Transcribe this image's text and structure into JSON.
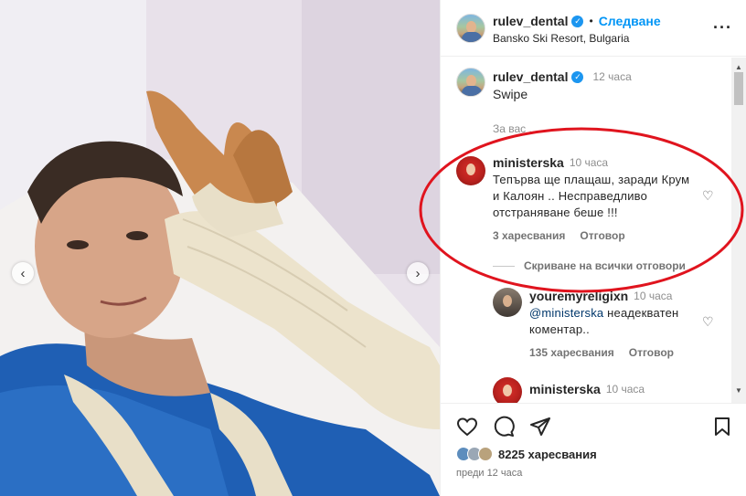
{
  "post": {
    "author": "rulev_dental",
    "follow_label": "Следване",
    "location": "Bansko Ski Resort, Bulgaria",
    "caption": "Swipe",
    "caption_time": "12 часа",
    "more_icon": "more-options-icon"
  },
  "comments_section": {
    "for_you_label": "За вас ...",
    "hide_replies_label": "Скриване на всички отговори",
    "comments": [
      {
        "user": "ministerska",
        "time": "10 часа",
        "text": "Тепърва ще плащаш, заради Крум и Калоян .. Несправедливо отстраняване беше !!!",
        "likes": "3 харесвания",
        "reply_label": "Отговор"
      }
    ],
    "replies": [
      {
        "user": "youremyreligixn",
        "time": "10 часа",
        "mention": "@ministerska",
        "text": " неадекватен коментар..",
        "likes": "135 харесвания",
        "reply_label": "Отговор"
      },
      {
        "user": "ministerska",
        "time": "10 часа"
      }
    ]
  },
  "footer": {
    "likes": "8225 харесвания",
    "posted": "преди 12 часа"
  },
  "colors": {
    "accent": "#0095f6",
    "verified": "#1c96f0",
    "highlight_ring": "#e0141e"
  }
}
